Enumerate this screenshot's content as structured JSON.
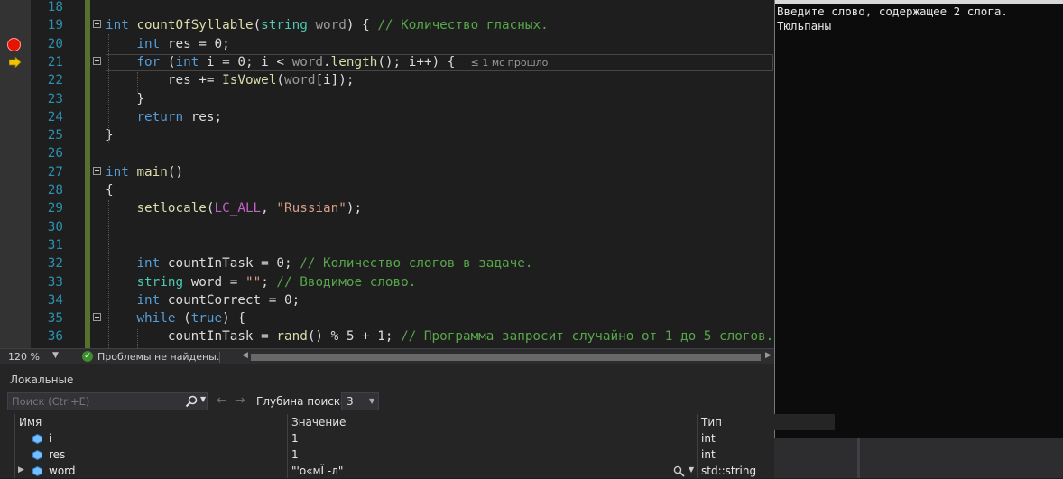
{
  "editor": {
    "lines": [
      {
        "n": "18",
        "tokens": []
      },
      {
        "n": "19",
        "fold": true,
        "tokens": [
          [
            "kw",
            "int "
          ],
          [
            "fn",
            "countOfSyllable"
          ],
          [
            "pl",
            "("
          ],
          [
            "ty",
            "string"
          ],
          [
            "pl",
            " "
          ],
          [
            "pa",
            "word"
          ],
          [
            "pl",
            ") { "
          ],
          [
            "cm",
            "// Количество гласных."
          ]
        ]
      },
      {
        "n": "20",
        "bp": true,
        "tokens": [
          [
            "pl",
            "    "
          ],
          [
            "kw",
            "int"
          ],
          [
            "pl",
            " res = 0;"
          ]
        ]
      },
      {
        "n": "21",
        "cur": true,
        "fold": true,
        "tokens": [
          [
            "pl",
            "    "
          ],
          [
            "kw",
            "for"
          ],
          [
            "pl",
            " ("
          ],
          [
            "kw",
            "int"
          ],
          [
            "pl",
            " i = 0; i < "
          ],
          [
            "pa",
            "word"
          ],
          [
            "pl",
            "."
          ],
          [
            "fn",
            "length"
          ],
          [
            "pl",
            "(); i++) {  "
          ],
          [
            "hint",
            "≤ 1 мс прошло"
          ]
        ]
      },
      {
        "n": "22",
        "tokens": [
          [
            "pl",
            "        res += "
          ],
          [
            "fn",
            "IsVowel"
          ],
          [
            "pl",
            "("
          ],
          [
            "pa",
            "word"
          ],
          [
            "pl",
            "[i]);"
          ]
        ]
      },
      {
        "n": "23",
        "tokens": [
          [
            "pl",
            "    }"
          ]
        ]
      },
      {
        "n": "24",
        "tokens": [
          [
            "pl",
            "    "
          ],
          [
            "kw",
            "return"
          ],
          [
            "pl",
            " res;"
          ]
        ]
      },
      {
        "n": "25",
        "tokens": [
          [
            "pl",
            "}"
          ]
        ]
      },
      {
        "n": "26",
        "tokens": []
      },
      {
        "n": "27",
        "fold": true,
        "tokens": [
          [
            "kw",
            "int "
          ],
          [
            "fn",
            "main"
          ],
          [
            "pl",
            "()"
          ]
        ]
      },
      {
        "n": "28",
        "tokens": [
          [
            "pl",
            "{"
          ]
        ]
      },
      {
        "n": "29",
        "tokens": [
          [
            "pl",
            "    "
          ],
          [
            "fn",
            "setlocale"
          ],
          [
            "pl",
            "("
          ],
          [
            "mac",
            "LC_ALL"
          ],
          [
            "pl",
            ", "
          ],
          [
            "st",
            "\"Russian\""
          ],
          [
            "pl",
            ");"
          ]
        ]
      },
      {
        "n": "30",
        "tokens": []
      },
      {
        "n": "31",
        "tokens": []
      },
      {
        "n": "32",
        "tokens": [
          [
            "pl",
            "    "
          ],
          [
            "kw",
            "int"
          ],
          [
            "pl",
            " countInTask = 0; "
          ],
          [
            "cm",
            "// Количество слогов в задаче."
          ]
        ]
      },
      {
        "n": "33",
        "tokens": [
          [
            "pl",
            "    "
          ],
          [
            "ty",
            "string"
          ],
          [
            "pl",
            " word = "
          ],
          [
            "st",
            "\"\""
          ],
          [
            "pl",
            "; "
          ],
          [
            "cm",
            "// Вводимое слово."
          ]
        ]
      },
      {
        "n": "34",
        "tokens": [
          [
            "pl",
            "    "
          ],
          [
            "kw",
            "int"
          ],
          [
            "pl",
            " countCorrect = 0;"
          ]
        ]
      },
      {
        "n": "35",
        "fold": true,
        "tokens": [
          [
            "pl",
            "    "
          ],
          [
            "kw",
            "while"
          ],
          [
            "pl",
            " ("
          ],
          [
            "kw",
            "true"
          ],
          [
            "pl",
            ") {"
          ]
        ]
      },
      {
        "n": "36",
        "tokens": [
          [
            "pl",
            "        countInTask = "
          ],
          [
            "fn",
            "rand"
          ],
          [
            "pl",
            "() % 5 + 1; "
          ],
          [
            "cm",
            "// Программа запросит случайно от 1 до 5 слогов."
          ]
        ]
      }
    ],
    "status": {
      "zoom": "120 %",
      "problems": "Проблемы не найдены."
    }
  },
  "console": {
    "lines": [
      "Введите слово, содержащее 2 слога.",
      "Тюльпаны"
    ]
  },
  "locals": {
    "title": "Локальные",
    "search_placeholder": "Поиск (Ctrl+E)",
    "depth_label": "Глубина поиска:",
    "depth_value": "3",
    "columns": {
      "name": "Имя",
      "value": "Значение",
      "type": "Тип"
    },
    "rows": [
      {
        "name": "i",
        "value": "1",
        "type": "int"
      },
      {
        "name": "res",
        "value": "1",
        "type": "int"
      },
      {
        "name": "word",
        "value": "\"'о«мЇ -л\"",
        "type": "std::string"
      }
    ]
  },
  "colors": {
    "keyword": "#569cd6",
    "type": "#4ec9b0",
    "function": "#dcdcaa",
    "comment": "#57a64a",
    "string": "#d69d85",
    "line_number": "#2b91af",
    "breakpoint": "#e51400",
    "change_bar": "#56712e"
  },
  "icons": [
    "breakpoint-icon",
    "current-line-arrow-icon",
    "check-circle-icon",
    "search-icon",
    "back-arrow-icon",
    "forward-arrow-icon",
    "variable-icon",
    "magnify-icon"
  ]
}
